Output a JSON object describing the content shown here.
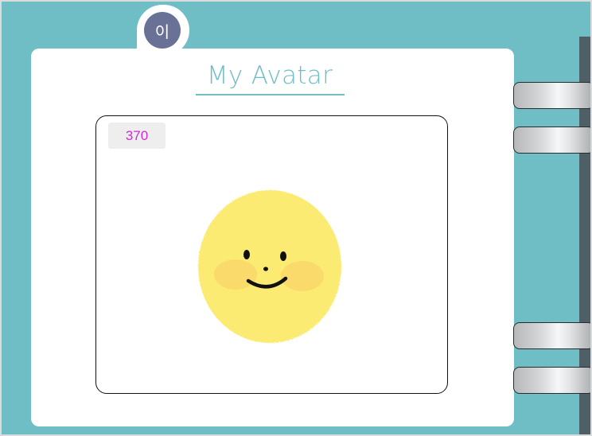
{
  "colors": {
    "background": "#6fbdc5",
    "accent": "#6fbdc5",
    "counter_text": "#d42ad6",
    "badge": "#6a7197"
  },
  "header": {
    "avatar_initial": "이",
    "title": "My Avatar"
  },
  "canvas": {
    "counter": "370",
    "image": "smiley-face"
  },
  "side_buttons": [
    {
      "label": ""
    },
    {
      "label": ""
    },
    {
      "label": ""
    },
    {
      "label": ""
    }
  ]
}
